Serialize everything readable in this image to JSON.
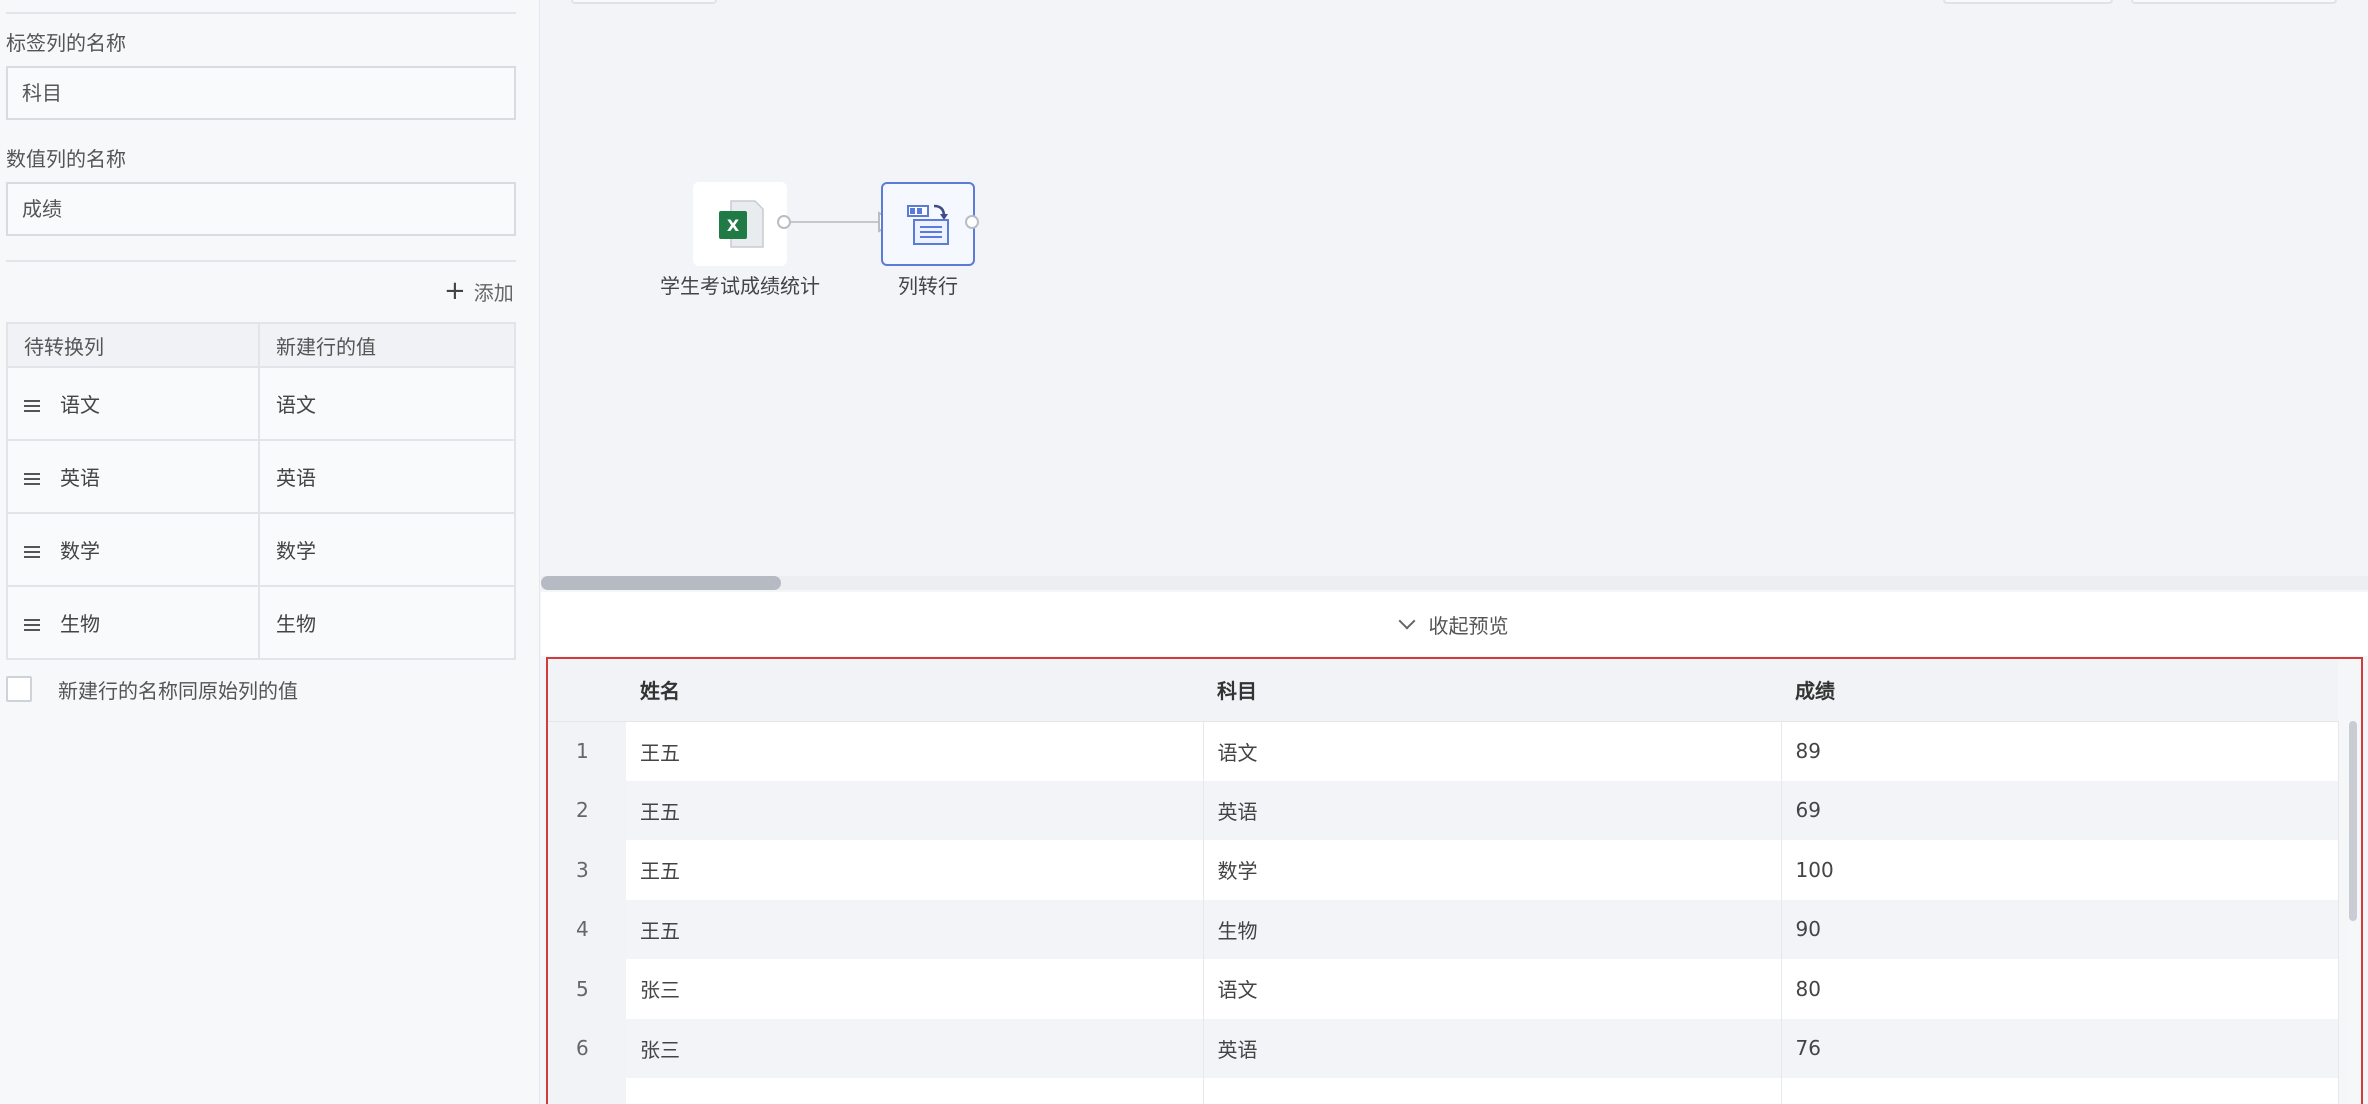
{
  "config": {
    "label_col_title": "标签列的名称",
    "label_col_value": "科目",
    "value_col_title": "数值列的名称",
    "value_col_value": "成绩",
    "add_label": "添加",
    "mapping_headers": [
      "待转换列",
      "新建行的值"
    ],
    "mapping_rows": [
      {
        "source": "语文",
        "value": "语文"
      },
      {
        "source": "英语",
        "value": "英语"
      },
      {
        "source": "数学",
        "value": "数学"
      },
      {
        "source": "生物",
        "value": "生物"
      }
    ],
    "same_name_checkbox_label": "新建行的名称同原始列的值"
  },
  "canvas": {
    "nodes": [
      {
        "label": "学生考试成绩统计",
        "icon": "excel-file-icon",
        "icon_color": "#1f7a45"
      },
      {
        "label": "列转行",
        "icon": "column-to-row-icon",
        "icon_color": "#5a7bd8"
      }
    ]
  },
  "preview": {
    "toggle_label": "收起预览",
    "headers": [
      "姓名",
      "科目",
      "成绩"
    ],
    "rows": [
      {
        "idx": "1",
        "name": "王五",
        "subject": "语文",
        "score": "89"
      },
      {
        "idx": "2",
        "name": "王五",
        "subject": "英语",
        "score": "69"
      },
      {
        "idx": "3",
        "name": "王五",
        "subject": "数学",
        "score": "100"
      },
      {
        "idx": "4",
        "name": "王五",
        "subject": "生物",
        "score": "90"
      },
      {
        "idx": "5",
        "name": "张三",
        "subject": "语文",
        "score": "80"
      },
      {
        "idx": "6",
        "name": "张三",
        "subject": "英语",
        "score": "76"
      }
    ]
  },
  "colors": {
    "highlight_border": "#d23b3b",
    "selected_node": "#5a7bd8"
  }
}
